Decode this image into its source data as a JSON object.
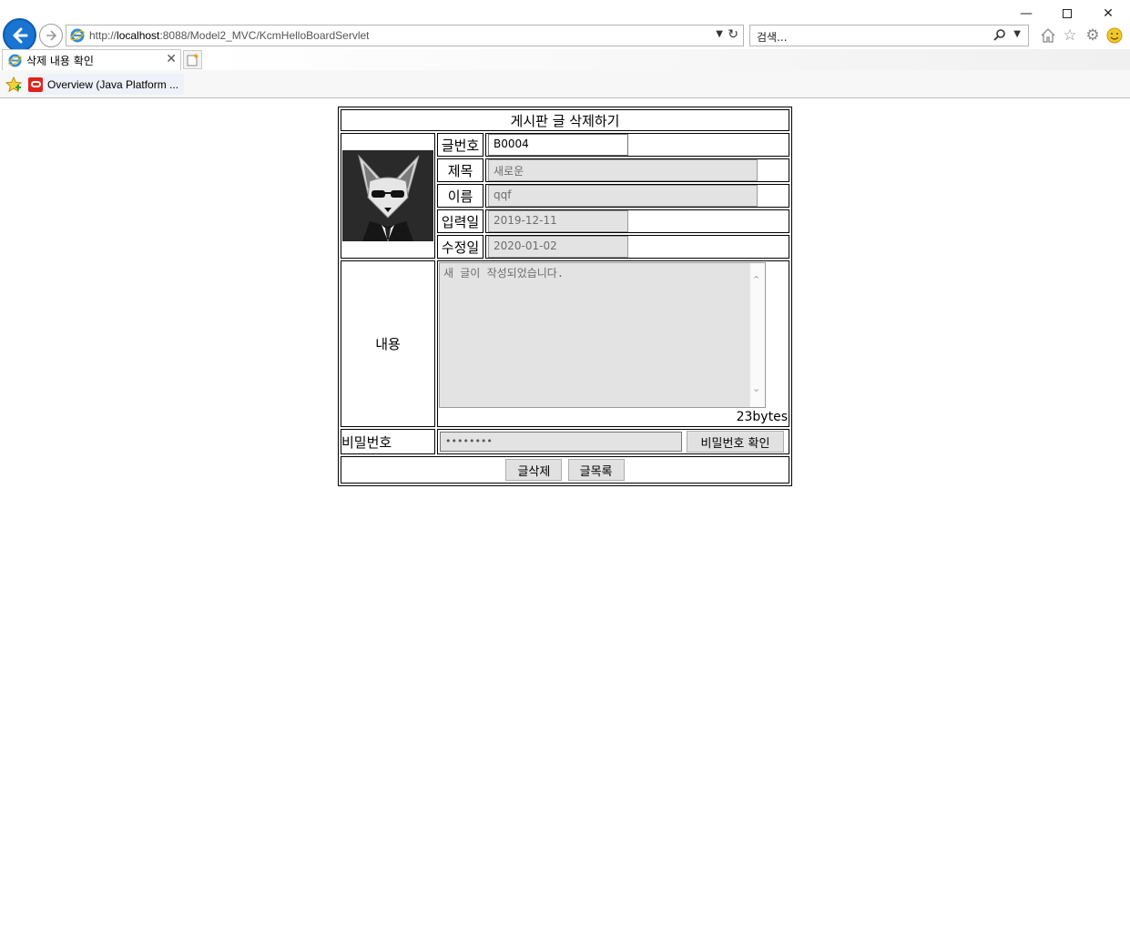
{
  "browser": {
    "url_prefix": "http://",
    "url_host": "localhost",
    "url_rest": ":8088/Model2_MVC/KcmHelloBoardServlet",
    "search_placeholder": "검색...",
    "tab_title": "삭제 내용 확인",
    "favorite_label": "Overview (Java Platform ...",
    "accent_color": "#1a75d2"
  },
  "board": {
    "title": "게시판 글 삭제하기",
    "labels": {
      "post_number": "글번호",
      "subject": "제목",
      "name": "이름",
      "created_date": "입력일",
      "modified_date": "수정일",
      "content": "내용",
      "password": "비밀번호"
    },
    "values": {
      "post_number": "B0004",
      "subject": "새로운",
      "name": "qqf",
      "created_date": "2019-12-11",
      "modified_date": "2020-01-02",
      "content": "새 글이 작성되었습니다.",
      "password": "••••••••"
    },
    "byte_count": "23bytes",
    "buttons": {
      "check_password": "비밀번호 확인",
      "delete": "글삭제",
      "list": "글목록"
    }
  }
}
